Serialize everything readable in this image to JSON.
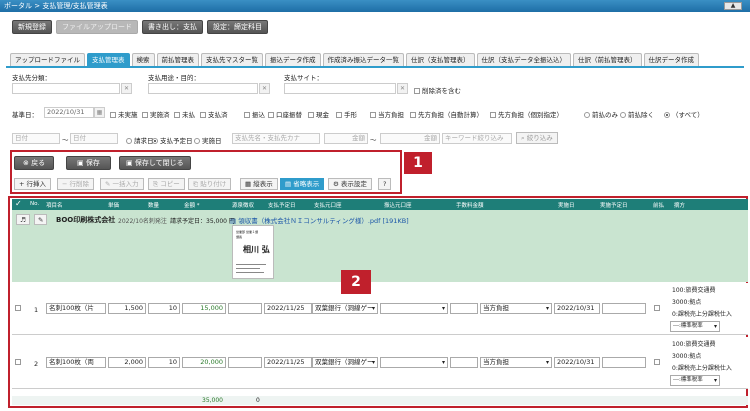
{
  "breadcrumb": "ポータル > 支払管理/支払管理表",
  "top_buttons": [
    "新規登録",
    "ファイルアップロード",
    "書き出し：支払",
    "設定：締定科目"
  ],
  "tabs": [
    "アップロードファイル",
    "支払管理表",
    "検索",
    "前払管理表",
    "支払先マスター覧",
    "振込データ作成",
    "作成済み振込データ一覧",
    "仕訳（支払管理表）",
    "仕訳（支払データ全振込込）",
    "仕訳（前払管理表）",
    "仕訳データ作成"
  ],
  "filters": {
    "payment_class_label": "支払先分類：",
    "purpose_label": "支払用途・目的：",
    "site_label": "支払サイト：",
    "exclude_deleted": "削除済を含む",
    "base_date_label": "基準日：",
    "base_date": "2022/10/31",
    "cal_icon": "▦",
    "status_opts": [
      "未実施",
      "実施済",
      "未払",
      "支払済"
    ],
    "method_opts": [
      "振込",
      "口座振替",
      "現金",
      "手形"
    ],
    "burden_opts": [
      "当方負担",
      "先方負担（自動計算）",
      "先方負担（個別指定）"
    ],
    "prepay_opts": [
      "前払のみ",
      "前払除く",
      "（すべて）"
    ],
    "date_from": "日付",
    "date_to": "日付",
    "date_kind": [
      "請求日",
      "支払予定日",
      "実施日"
    ],
    "vendor_search_ph": "支払先名・支払先カナ",
    "amount_from_ph": "金額",
    "amount_to_ph": "金額",
    "keyword_ph": "キーワード絞り込み",
    "narrow_btn": "絞り込み"
  },
  "toolbar": {
    "back": "戻る",
    "save": "保存",
    "save_close": "保存して閉じる",
    "insert": "行挿入",
    "delete": "行削除",
    "bulk_input": "一括入力",
    "copy": "コピー",
    "paste": "貼り付け",
    "vertical": "縦表示",
    "compact": "省略表示",
    "view_settings": "表示設定",
    "help": "?"
  },
  "callouts": [
    "1",
    "2"
  ],
  "columns": [
    "No.",
    "項目名",
    "単価",
    "数量",
    "金額 *",
    "源泉徴収",
    "支払予定日",
    "支払元口座",
    "振込元口座",
    "手数料金額",
    "実施日",
    "実施予定日",
    "前払",
    "摘方"
  ],
  "vendor": {
    "name": "BOO印刷株式会社",
    "note": "2022/10名刺発注",
    "req_date": "請求予定日：35,000 円",
    "file": "領収書（株式会社ＮＩコンサルティング様）.pdf [191KB]",
    "card_name": "相川 弘",
    "card_small1": "営業部 営業１課",
    "card_small2": "課長"
  },
  "rows": [
    {
      "no": "1",
      "item": "名刺100枚（片",
      "price": "1,500",
      "qty": "10",
      "amount": "15,000",
      "date": "2022/11/25",
      "bank": "双葉銀行（洞線ゲー",
      "fee": "当方負担",
      "impl": "2022/10/31",
      "notes": [
        "100:旅費交通費",
        "3000:拠点",
        "0:課税売上分課税仕入"
      ],
      "tax": "---:標準税率"
    },
    {
      "no": "2",
      "item": "名刺100枚（両",
      "price": "2,000",
      "qty": "10",
      "amount": "20,000",
      "date": "2022/11/25",
      "bank": "双葉銀行（洞線ゲー",
      "fee": "当方負担",
      "impl": "2022/10/31",
      "notes": [
        "100:旅費交通費",
        "3000:拠点",
        "0:課税売上分課税仕入"
      ],
      "tax": "---:標準税率"
    }
  ],
  "footer": {
    "total": "35,000",
    "withholding": "0"
  }
}
